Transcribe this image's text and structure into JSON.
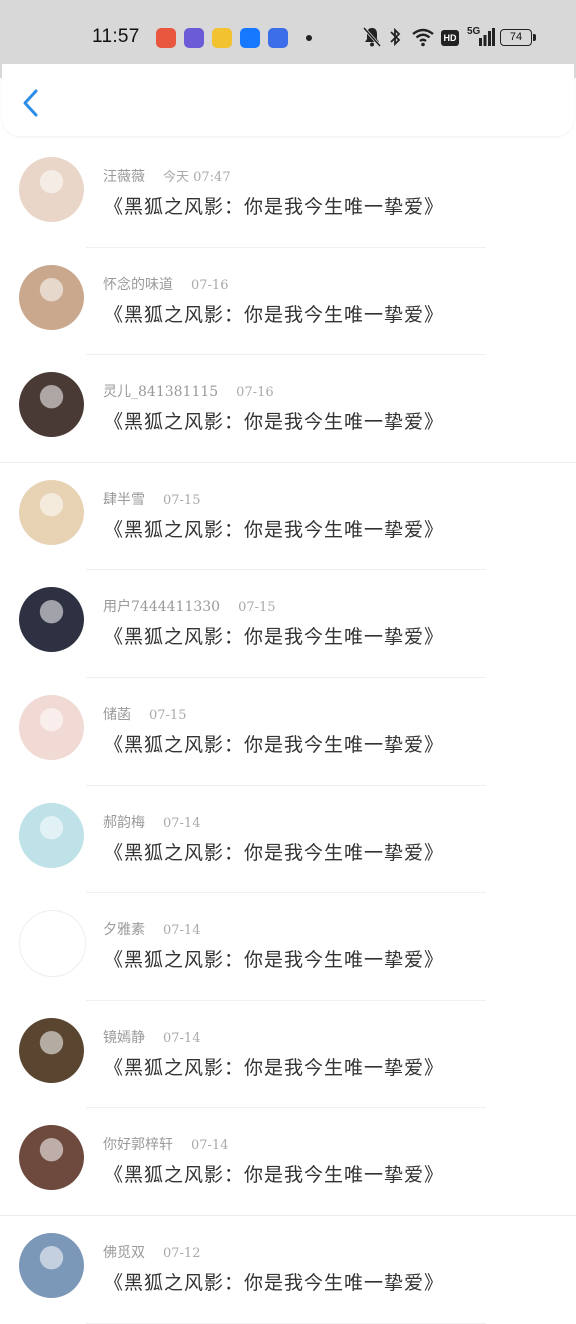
{
  "status_bar": {
    "time": "11:57",
    "battery": "74",
    "network": "5G",
    "hd": "HD",
    "app_icons": [
      {
        "name": "gallery-app-icon",
        "color": "#e9573f"
      },
      {
        "name": "message-app-icon",
        "color": "#6b5bd6"
      },
      {
        "name": "weibo-app-icon",
        "color": "#f2c230"
      },
      {
        "name": "alipay-app-icon",
        "color": "#1677ff"
      },
      {
        "name": "baidu-app-icon",
        "color": "#3b6ee8"
      }
    ]
  },
  "header": {
    "back_icon": "chevron-left-icon",
    "accent": "#2b8de8"
  },
  "messages": [
    {
      "name": "汪薇薇",
      "time": "今天 07:47",
      "text": "《黑狐之风影：你是我今生唯一挚爱》",
      "avatar_color": "#e9d6c8"
    },
    {
      "name": "怀念的味道",
      "time": "07-16",
      "text": "《黑狐之风影：你是我今生唯一挚爱》",
      "avatar_color": "#c9a88e"
    },
    {
      "name": "灵儿_841381115",
      "time": "07-16",
      "text": "《黑狐之风影：你是我今生唯一挚爱》",
      "avatar_color": "#4a3a35"
    },
    {
      "name": "肆半雪",
      "time": "07-15",
      "text": "《黑狐之风影：你是我今生唯一挚爱》",
      "avatar_color": "#e7d2b4"
    },
    {
      "name": "用户7444411330",
      "time": "07-15",
      "text": "《黑狐之风影：你是我今生唯一挚爱》",
      "avatar_color": "#2e3142"
    },
    {
      "name": "储菡",
      "time": "07-15",
      "text": "《黑狐之风影：你是我今生唯一挚爱》",
      "avatar_color": "#f1d9d4"
    },
    {
      "name": "郝韵梅",
      "time": "07-14",
      "text": "《黑狐之风影：你是我今生唯一挚爱》",
      "avatar_color": "#bfe1e8"
    },
    {
      "name": "夕雅素",
      "time": "07-14",
      "text": "《黑狐之风影：你是我今生唯一挚爱》",
      "avatar_color": "#ffffff"
    },
    {
      "name": "镜嫣静",
      "time": "07-14",
      "text": "《黑狐之风影：你是我今生唯一挚爱》",
      "avatar_color": "#5a4630"
    },
    {
      "name": "你好郭梓轩",
      "time": "07-14",
      "text": "《黑狐之风影：你是我今生唯一挚爱》",
      "avatar_color": "#6e4a3e"
    },
    {
      "name": "佛觅双",
      "time": "07-12",
      "text": "《黑狐之风影：你是我今生唯一挚爱》",
      "avatar_color": "#7c98b8"
    }
  ]
}
